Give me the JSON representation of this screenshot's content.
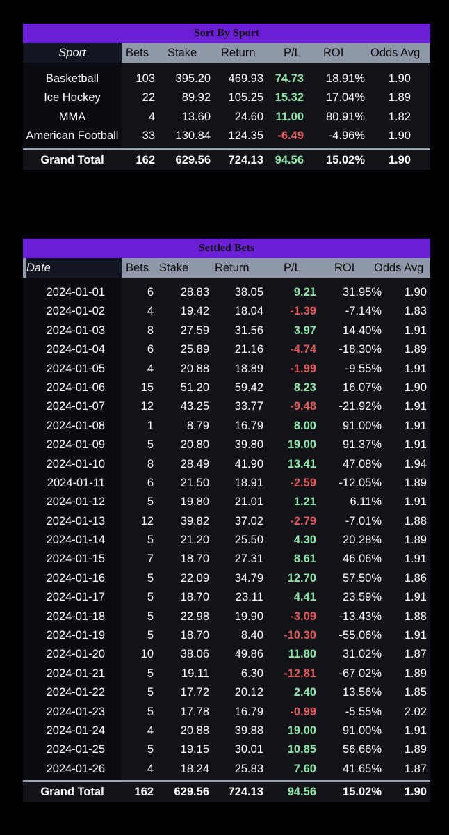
{
  "sport_table": {
    "title": "Sort By Sport",
    "headers": [
      "Sport",
      "Bets",
      "Stake",
      "Return",
      "P/L",
      "ROI",
      "Odds Avg"
    ],
    "rows": [
      {
        "name": "Basketball",
        "bets": "103",
        "stake": "395.20",
        "return": "469.93",
        "pl": "74.73",
        "roi": "18.91%",
        "odds": "1.90",
        "pl_sign": "pos"
      },
      {
        "name": "Ice Hockey",
        "bets": "22",
        "stake": "89.92",
        "return": "105.25",
        "pl": "15.32",
        "roi": "17.04%",
        "odds": "1.89",
        "pl_sign": "pos"
      },
      {
        "name": "MMA",
        "bets": "4",
        "stake": "13.60",
        "return": "24.60",
        "pl": "11.00",
        "roi": "80.91%",
        "odds": "1.82",
        "pl_sign": "pos"
      },
      {
        "name": "American Football",
        "bets": "33",
        "stake": "130.84",
        "return": "124.35",
        "pl": "-6.49",
        "roi": "-4.96%",
        "odds": "1.90",
        "pl_sign": "neg"
      }
    ],
    "total": {
      "name": "Grand Total",
      "bets": "162",
      "stake": "629.56",
      "return": "724.13",
      "pl": "94.56",
      "roi": "15.02%",
      "odds": "1.90"
    }
  },
  "settled_table": {
    "title": "Settled Bets",
    "headers": [
      "Date",
      "Bets",
      "Stake",
      "Return",
      "P/L",
      "ROI",
      "Odds Avg"
    ],
    "rows": [
      {
        "name": "2024-01-01",
        "bets": "6",
        "stake": "28.83",
        "return": "38.05",
        "pl": "9.21",
        "roi": "31.95%",
        "odds": "1.90",
        "pl_sign": "pos"
      },
      {
        "name": "2024-01-02",
        "bets": "4",
        "stake": "19.42",
        "return": "18.04",
        "pl": "-1.39",
        "roi": "-7.14%",
        "odds": "1.83",
        "pl_sign": "neg"
      },
      {
        "name": "2024-01-03",
        "bets": "8",
        "stake": "27.59",
        "return": "31.56",
        "pl": "3.97",
        "roi": "14.40%",
        "odds": "1.91",
        "pl_sign": "pos"
      },
      {
        "name": "2024-01-04",
        "bets": "6",
        "stake": "25.89",
        "return": "21.16",
        "pl": "-4.74",
        "roi": "-18.30%",
        "odds": "1.89",
        "pl_sign": "neg"
      },
      {
        "name": "2024-01-05",
        "bets": "4",
        "stake": "20.88",
        "return": "18.89",
        "pl": "-1.99",
        "roi": "-9.55%",
        "odds": "1.91",
        "pl_sign": "neg"
      },
      {
        "name": "2024-01-06",
        "bets": "15",
        "stake": "51.20",
        "return": "59.42",
        "pl": "8.23",
        "roi": "16.07%",
        "odds": "1.90",
        "pl_sign": "pos"
      },
      {
        "name": "2024-01-07",
        "bets": "12",
        "stake": "43.25",
        "return": "33.77",
        "pl": "-9.48",
        "roi": "-21.92%",
        "odds": "1.91",
        "pl_sign": "neg"
      },
      {
        "name": "2024-01-08",
        "bets": "1",
        "stake": "8.79",
        "return": "16.79",
        "pl": "8.00",
        "roi": "91.00%",
        "odds": "1.91",
        "pl_sign": "pos"
      },
      {
        "name": "2024-01-09",
        "bets": "5",
        "stake": "20.80",
        "return": "39.80",
        "pl": "19.00",
        "roi": "91.37%",
        "odds": "1.91",
        "pl_sign": "pos"
      },
      {
        "name": "2024-01-10",
        "bets": "8",
        "stake": "28.49",
        "return": "41.90",
        "pl": "13.41",
        "roi": "47.08%",
        "odds": "1.94",
        "pl_sign": "pos"
      },
      {
        "name": "2024-01-11",
        "bets": "6",
        "stake": "21.50",
        "return": "18.91",
        "pl": "-2.59",
        "roi": "-12.05%",
        "odds": "1.89",
        "pl_sign": "neg"
      },
      {
        "name": "2024-01-12",
        "bets": "5",
        "stake": "19.80",
        "return": "21.01",
        "pl": "1.21",
        "roi": "6.11%",
        "odds": "1.91",
        "pl_sign": "pos"
      },
      {
        "name": "2024-01-13",
        "bets": "12",
        "stake": "39.82",
        "return": "37.02",
        "pl": "-2.79",
        "roi": "-7.01%",
        "odds": "1.88",
        "pl_sign": "neg"
      },
      {
        "name": "2024-01-14",
        "bets": "5",
        "stake": "21.20",
        "return": "25.50",
        "pl": "4.30",
        "roi": "20.28%",
        "odds": "1.89",
        "pl_sign": "pos"
      },
      {
        "name": "2024-01-15",
        "bets": "7",
        "stake": "18.70",
        "return": "27.31",
        "pl": "8.61",
        "roi": "46.06%",
        "odds": "1.91",
        "pl_sign": "pos"
      },
      {
        "name": "2024-01-16",
        "bets": "5",
        "stake": "22.09",
        "return": "34.79",
        "pl": "12.70",
        "roi": "57.50%",
        "odds": "1.86",
        "pl_sign": "pos"
      },
      {
        "name": "2024-01-17",
        "bets": "5",
        "stake": "18.70",
        "return": "23.11",
        "pl": "4.41",
        "roi": "23.59%",
        "odds": "1.91",
        "pl_sign": "pos"
      },
      {
        "name": "2024-01-18",
        "bets": "5",
        "stake": "22.98",
        "return": "19.90",
        "pl": "-3.09",
        "roi": "-13.43%",
        "odds": "1.88",
        "pl_sign": "neg"
      },
      {
        "name": "2024-01-19",
        "bets": "5",
        "stake": "18.70",
        "return": "8.40",
        "pl": "-10.30",
        "roi": "-55.06%",
        "odds": "1.91",
        "pl_sign": "neg"
      },
      {
        "name": "2024-01-20",
        "bets": "10",
        "stake": "38.06",
        "return": "49.86",
        "pl": "11.80",
        "roi": "31.02%",
        "odds": "1.87",
        "pl_sign": "pos"
      },
      {
        "name": "2024-01-21",
        "bets": "5",
        "stake": "19.11",
        "return": "6.30",
        "pl": "-12.81",
        "roi": "-67.02%",
        "odds": "1.89",
        "pl_sign": "neg"
      },
      {
        "name": "2024-01-22",
        "bets": "5",
        "stake": "17.72",
        "return": "20.12",
        "pl": "2.40",
        "roi": "13.56%",
        "odds": "1.85",
        "pl_sign": "pos"
      },
      {
        "name": "2024-01-23",
        "bets": "5",
        "stake": "17.78",
        "return": "16.79",
        "pl": "-0.99",
        "roi": "-5.55%",
        "odds": "2.02",
        "pl_sign": "neg"
      },
      {
        "name": "2024-01-24",
        "bets": "4",
        "stake": "20.88",
        "return": "39.88",
        "pl": "19.00",
        "roi": "91.00%",
        "odds": "1.91",
        "pl_sign": "pos"
      },
      {
        "name": "2024-01-25",
        "bets": "5",
        "stake": "19.15",
        "return": "30.01",
        "pl": "10.85",
        "roi": "56.66%",
        "odds": "1.89",
        "pl_sign": "pos"
      },
      {
        "name": "2024-01-26",
        "bets": "4",
        "stake": "18.24",
        "return": "25.83",
        "pl": "7.60",
        "roi": "41.65%",
        "odds": "1.87",
        "pl_sign": "pos"
      }
    ],
    "total": {
      "name": "Grand Total",
      "bets": "162",
      "stake": "629.56",
      "return": "724.13",
      "pl": "94.56",
      "roi": "15.02%",
      "odds": "1.90"
    }
  },
  "colors": {
    "title_bar": "#6a1fd6",
    "header_bar": "#8f98a8",
    "positive": "#8ee6a8",
    "negative": "#e05a5a"
  }
}
